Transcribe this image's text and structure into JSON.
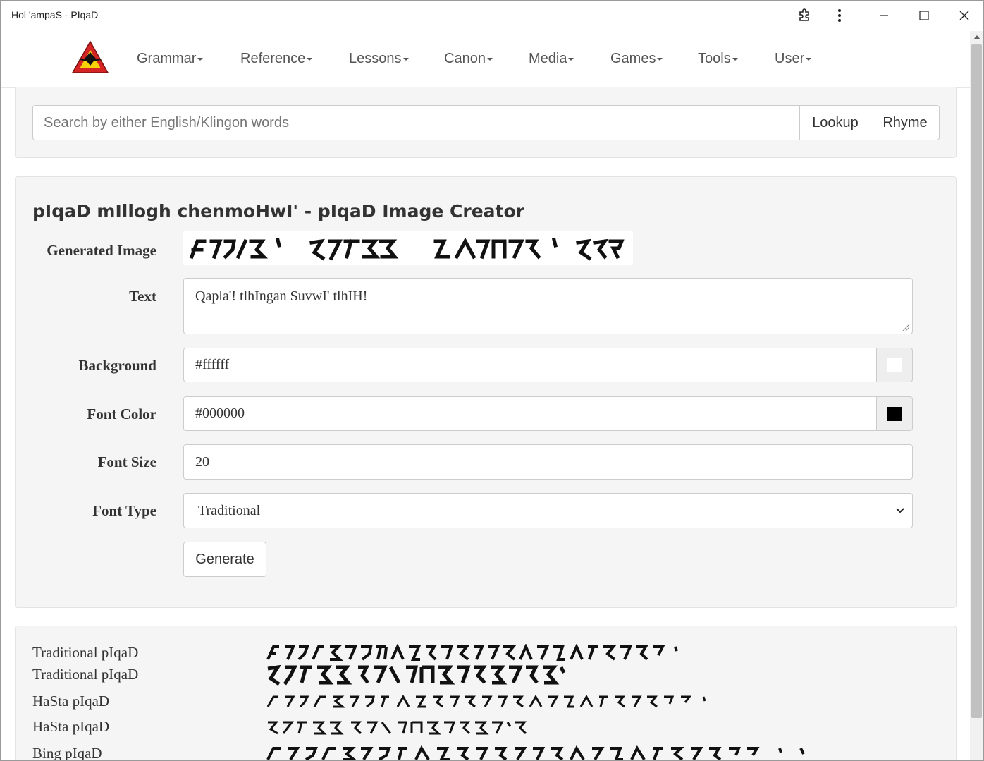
{
  "window": {
    "title": "Hol 'ampaS - PIqaD",
    "controls": [
      "extensions-icon",
      "more-icon",
      "minimize-icon",
      "maximize-icon",
      "close-icon"
    ]
  },
  "nav": {
    "items": [
      {
        "label": "Grammar"
      },
      {
        "label": "Reference"
      },
      {
        "label": "Lessons"
      },
      {
        "label": "Canon"
      },
      {
        "label": "Media"
      },
      {
        "label": "Games"
      },
      {
        "label": "Tools"
      },
      {
        "label": "User"
      }
    ]
  },
  "search": {
    "placeholder": "Search by either English/Klingon words",
    "lookup_label": "Lookup",
    "rhyme_label": "Rhyme"
  },
  "creator": {
    "title": "pIqaD mIllogh chenmoHwI' - pIqaD Image Creator",
    "generated_image_label": "Generated Image",
    "text_label": "Text",
    "text_value": "Qapla'! tlhIngan SuvwI' tlhIH!",
    "background_label": "Background",
    "background_value": "#ffffff",
    "font_color_label": "Font Color",
    "font_color_value": "#000000",
    "font_size_label": "Font Size",
    "font_size_value": "20",
    "font_type_label": "Font Type",
    "font_type_value": "Traditional",
    "generate_label": "Generate"
  },
  "fonts": {
    "rows": [
      {
        "label": "Traditional pIqaD"
      },
      {
        "label": "Traditional pIqaD"
      },
      {
        "label": "HaSta pIqaD"
      },
      {
        "label": "HaSta pIqaD"
      },
      {
        "label": "Bing pIqaD"
      }
    ]
  },
  "colors": {
    "background_swatch": "#ffffff",
    "font_swatch": "#000000",
    "logo_red": "#d42424",
    "logo_yellow": "#f5d20a"
  }
}
